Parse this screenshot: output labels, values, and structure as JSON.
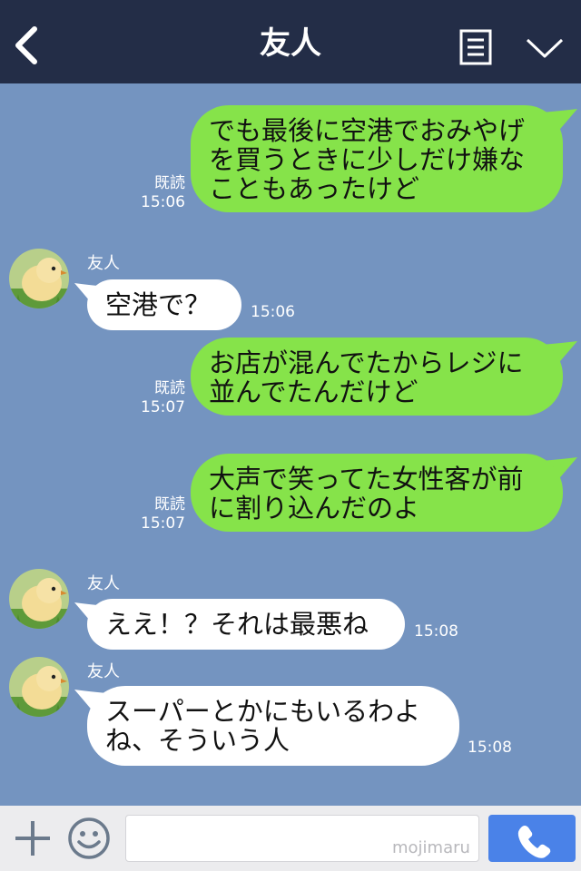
{
  "header": {
    "title": "友人"
  },
  "messages": [
    {
      "text": "でも最後に空港でおみやげ\nを買うときに少しだけ嫌な\nこともあったけど",
      "read": "既読",
      "time": "15:06"
    },
    {
      "sender": "友人",
      "text": "空港で？",
      "time": "15:06"
    },
    {
      "text": "お店が混んでたからレジに\n並んでたんだけど",
      "read": "既読",
      "time": "15:07"
    },
    {
      "text": "大声で笑ってた女性客が前\nに割り込んだのよ",
      "read": "既読",
      "time": "15:07"
    },
    {
      "sender": "友人",
      "text": "ええ！？それは最悪ね",
      "time": "15:08"
    },
    {
      "sender": "友人",
      "text": "スーパーとかにもいるわよ\nね、そういう人",
      "time": "15:08"
    }
  ],
  "input": {
    "watermark": "mojimaru"
  },
  "icons": {
    "back": "chevron-left-icon",
    "menu": "notes-icon",
    "collapse": "chevron-down-icon",
    "add": "plus-icon",
    "emoji": "smile-icon",
    "call": "phone-icon",
    "avatar": "chick-avatar"
  },
  "colors": {
    "header_bg": "#232d47",
    "chat_bg": "#7494c0",
    "outgoing_bubble": "#86e34a",
    "incoming_bubble": "#ffffff",
    "call_button": "#4a82e8"
  }
}
